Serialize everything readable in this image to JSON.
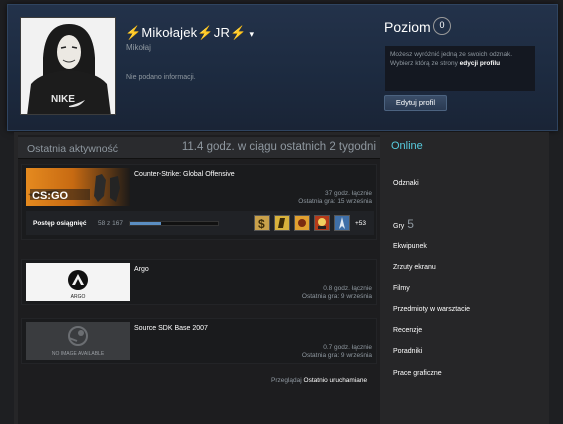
{
  "profile": {
    "persona_name": "⚡Mikołajek⚡JR⚡",
    "real_name": "Mikołaj",
    "summary": "Nie podano informacji.",
    "level_label": "Poziom",
    "level": "0",
    "level_info_text": "Możesz wyróżnić jedną ze swoich odznak. Wybierz którą ze strony",
    "level_info_link": "edycji profilu",
    "edit_button": "Edytuj profil",
    "avatar_shirt_text": "NIKE"
  },
  "activity": {
    "title": "Ostatnia aktywność",
    "hours": "11.4 godz. w ciągu ostatnich 2 tygodni",
    "games": [
      {
        "name": "Counter-Strike: Global Offensive",
        "capsule_text": "CS:GO",
        "hours": "37 godz. łącznie",
        "last_played": "Ostatnia gra: 15 września",
        "achievements": {
          "label": "Postęp osiągnięć",
          "count": "58 z 167",
          "progress": 0.347,
          "more": "+53"
        }
      },
      {
        "name": "Argo",
        "capsule_text": "ARGO",
        "hours": "0.8 godz. łącznie",
        "last_played": "Ostatnia gra: 9 września"
      },
      {
        "name": "Source SDK Base 2007",
        "capsule_text": "NO IMAGE AVAILABLE",
        "hours": "0.7 godz. łącznie",
        "last_played": "Ostatnia gra: 9 września"
      }
    ],
    "browse_prefix": "Przeglądaj",
    "browse_link": "Ostatnio uruchamiane"
  },
  "sidebar": {
    "status": "Online",
    "items": [
      "Odznaki",
      "Gry",
      "Ekwipunek",
      "Zrzuty ekranu",
      "Filmy",
      "Przedmioty w warsztacie",
      "Recenzje",
      "Poradniki",
      "Prace graficzne"
    ],
    "games_count": "5"
  },
  "colors": {
    "accent": "#57cbde",
    "progress": "#5b8ec2",
    "header_bg": "#1c2a3f"
  }
}
